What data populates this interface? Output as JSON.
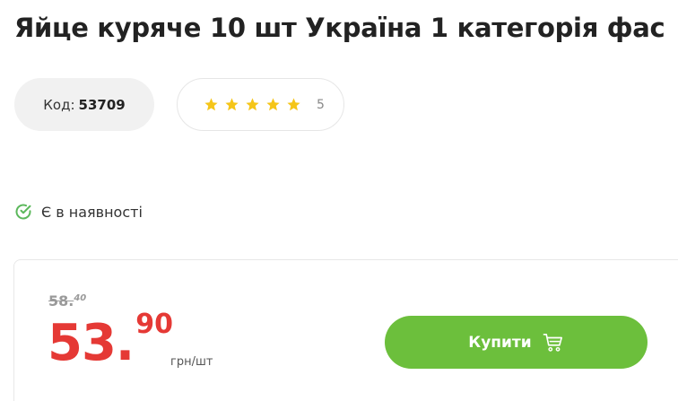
{
  "product": {
    "title": "Яйце куряче 10 шт Україна 1 категорія фас",
    "code_label": "Код:",
    "code_value": "53709"
  },
  "rating": {
    "stars": 5,
    "count": "5",
    "star_color": "#f5c518"
  },
  "availability": {
    "text": "Є в наявності",
    "icon": "check-circle-icon",
    "color": "#5cb85c"
  },
  "price": {
    "old_main": "58.",
    "old_cents": "40",
    "new_main": "53.",
    "new_cents": "90",
    "unit": "грн/шт",
    "accent_color": "#e53935"
  },
  "buy_button": {
    "label": "Купити",
    "icon": "cart-icon",
    "color": "#6cbf3c"
  }
}
